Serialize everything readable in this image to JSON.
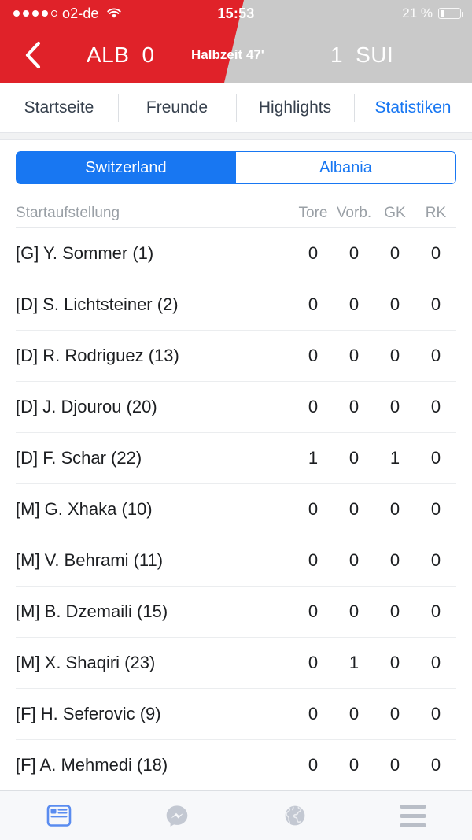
{
  "status_bar": {
    "carrier": "o2-de",
    "signal_dots_filled": 4,
    "signal_dots_total": 5,
    "wifi_icon": "wifi-icon",
    "time": "15:53",
    "battery_percent": "21 %",
    "battery_level": 21
  },
  "match_header": {
    "back_icon": "back-chevron-icon",
    "home_team": "ALB",
    "home_score": "0",
    "status": "Halbzeit 47'",
    "away_score": "1",
    "away_team": "SUI",
    "home_color": "#e02229",
    "away_color": "#c9c9c9"
  },
  "nav_tabs": [
    {
      "label": "Startseite",
      "active": false
    },
    {
      "label": "Freunde",
      "active": false
    },
    {
      "label": "Highlights",
      "active": false
    },
    {
      "label": "Statistiken",
      "active": true
    }
  ],
  "team_segment": {
    "options": [
      {
        "label": "Switzerland",
        "selected": true
      },
      {
        "label": "Albania",
        "selected": false
      }
    ],
    "accent_color": "#1877f2"
  },
  "table": {
    "headers": {
      "name": "Startaufstellung",
      "goals": "Tore",
      "assists": "Vorb.",
      "yellow": "GK",
      "red": "RK"
    },
    "rows": [
      {
        "name": "[G] Y. Sommer (1)",
        "goals": "0",
        "assists": "0",
        "yellow": "0",
        "red": "0"
      },
      {
        "name": "[D] S. Lichtsteiner (2)",
        "goals": "0",
        "assists": "0",
        "yellow": "0",
        "red": "0"
      },
      {
        "name": "[D] R. Rodriguez (13)",
        "goals": "0",
        "assists": "0",
        "yellow": "0",
        "red": "0"
      },
      {
        "name": "[D] J. Djourou (20)",
        "goals": "0",
        "assists": "0",
        "yellow": "0",
        "red": "0"
      },
      {
        "name": "[D] F. Schar (22)",
        "goals": "1",
        "assists": "0",
        "yellow": "1",
        "red": "0"
      },
      {
        "name": "[M] G. Xhaka (10)",
        "goals": "0",
        "assists": "0",
        "yellow": "0",
        "red": "0"
      },
      {
        "name": "[M] V. Behrami (11)",
        "goals": "0",
        "assists": "0",
        "yellow": "0",
        "red": "0"
      },
      {
        "name": "[M] B. Dzemaili (15)",
        "goals": "0",
        "assists": "0",
        "yellow": "0",
        "red": "0"
      },
      {
        "name": "[M] X. Shaqiri (23)",
        "goals": "0",
        "assists": "1",
        "yellow": "0",
        "red": "0"
      },
      {
        "name": "[F] H. Seferovic (9)",
        "goals": "0",
        "assists": "0",
        "yellow": "0",
        "red": "0"
      },
      {
        "name": "[F] A. Mehmedi (18)",
        "goals": "0",
        "assists": "0",
        "yellow": "0",
        "red": "0"
      }
    ]
  },
  "bottom_bar": {
    "items": [
      {
        "icon": "news-feed-icon",
        "active": true
      },
      {
        "icon": "messenger-icon",
        "active": false
      },
      {
        "icon": "globe-icon",
        "active": false
      },
      {
        "icon": "hamburger-menu-icon",
        "active": false
      }
    ]
  }
}
